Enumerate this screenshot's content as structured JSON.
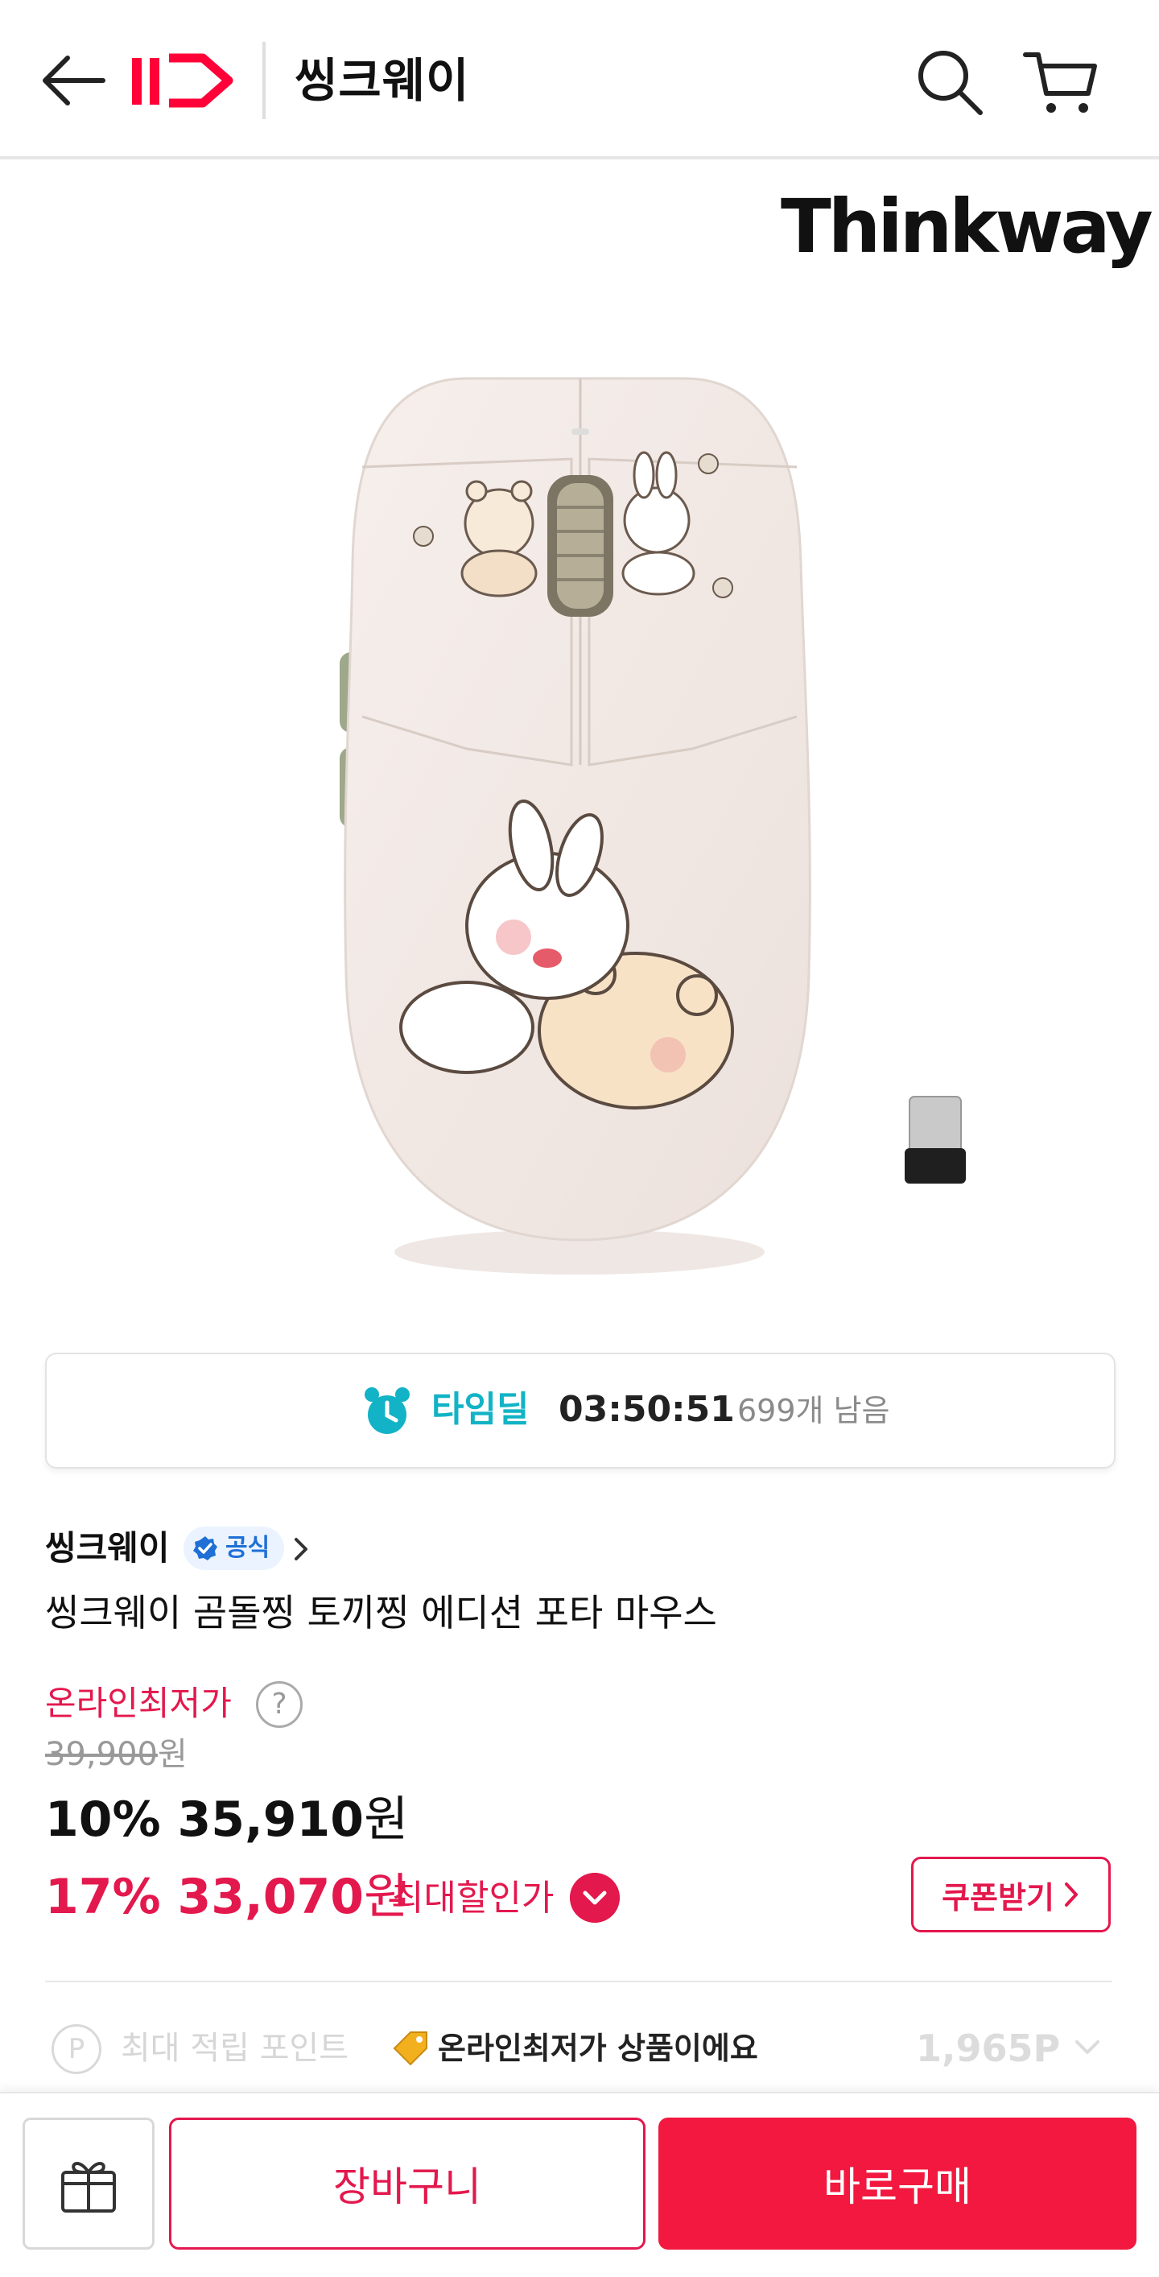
{
  "header": {
    "title": "씽크웨이",
    "logo_text": "11"
  },
  "product": {
    "brand_logo": "Thinkway",
    "image_icon": "wireless-mouse-image"
  },
  "time_deal": {
    "label": "타임딜",
    "countdown": "03:50:51",
    "remaining": "699개 남음",
    "accent": "#12b3c6"
  },
  "seller": {
    "name": "씽크웨이",
    "badge": "공식"
  },
  "product_title": "씽크웨이 곰돌찡 토끼찡 에디션 포타 마우스",
  "price": {
    "lowest_label": "온라인최저가",
    "help": "?",
    "original": "39,900",
    "original_unit": "원",
    "discount1_pct": "10%",
    "discount1_price": "35,910",
    "discount1_unit": "원",
    "discount2_pct": "17%",
    "discount2_price": "33,070",
    "discount2_unit": "원",
    "max_label": "최대할인가",
    "coupon_label": "쿠폰받기",
    "accent": "#e3184d"
  },
  "points": {
    "icon": "P",
    "label": "최대 적립 포인트",
    "toast": "온라인최저가 상품이에요",
    "value": "1,965P"
  },
  "bottom_bar": {
    "cart_label": "장바구니",
    "buy_label": "바로구매",
    "buy_color": "#f3183f"
  }
}
